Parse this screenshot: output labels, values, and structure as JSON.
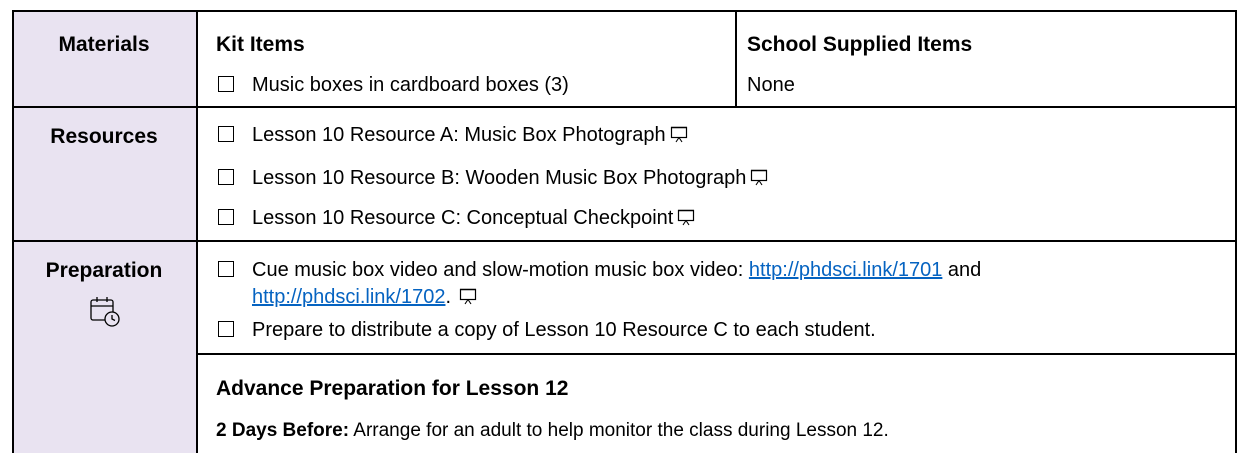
{
  "materials": {
    "label": "Materials",
    "kit_header": "Kit Items",
    "school_header": "School Supplied Items",
    "kit_items": [
      "Music boxes in cardboard boxes (3)"
    ],
    "school_items": [
      "None"
    ]
  },
  "resources": {
    "label": "Resources",
    "items": [
      "Lesson 10 Resource A: Music Box Photograph",
      "Lesson 10 Resource B: Wooden Music Box Photograph",
      "Lesson 10 Resource C: Conceptual Checkpoint"
    ]
  },
  "preparation": {
    "label": "Preparation",
    "item1_text": "Cue music box video and slow-motion music box video: ",
    "link1": "http://phdsci.link/1701",
    "and_text": " and",
    "link2": "http://phdsci.link/1702",
    "period": ".",
    "item2_text": "Prepare to distribute a copy of Lesson 10 Resource C to each student.",
    "advance_header": "Advance Preparation for Lesson 12",
    "advance_bold": "2 Days Before:",
    "advance_text": " Arrange for an adult to help monitor the class during Lesson 12."
  },
  "icons": {
    "checkbox": "checkbox-icon",
    "projector": "projector-screen-icon",
    "calendar": "calendar-clock-icon"
  },
  "colors": {
    "label_bg": "#e9e3f1",
    "link": "#0563c1"
  }
}
